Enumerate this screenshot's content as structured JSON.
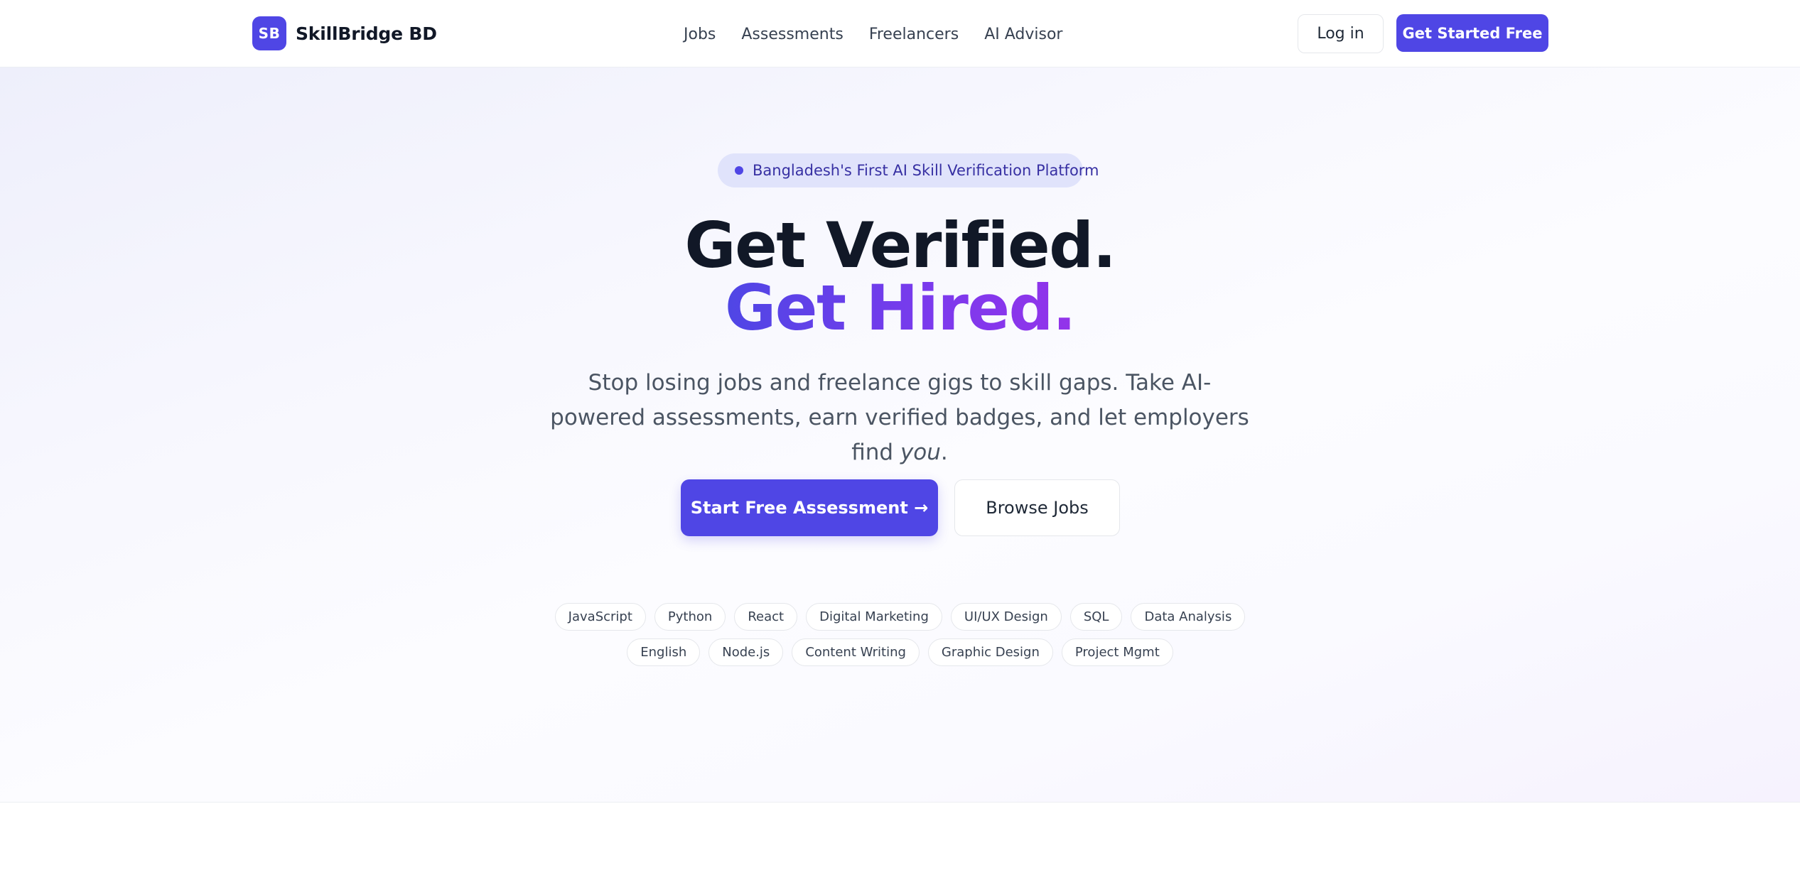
{
  "header": {
    "logo_initials": "SB",
    "brand_name": "SkillBridge BD",
    "nav": [
      {
        "label": "Jobs"
      },
      {
        "label": "Assessments"
      },
      {
        "label": "Freelancers"
      },
      {
        "label": "AI Advisor"
      }
    ],
    "login_label": "Log in",
    "cta_label": "Get Started Free"
  },
  "hero": {
    "badge_text": "Bangladesh's First AI Skill Verification Platform",
    "title_line1": "Get Verified.",
    "title_line2": "Get Hired.",
    "subtitle_main": "Stop losing jobs and freelance gigs to skill gaps. Take AI-powered assessments, earn verified badges, and let employers find ",
    "subtitle_emphasis": "you",
    "subtitle_end": ".",
    "primary_button": "Start Free Assessment →",
    "secondary_button": "Browse Jobs",
    "skills_row1": [
      "JavaScript",
      "Python",
      "React",
      "Digital Marketing",
      "UI/UX Design",
      "SQL",
      "Data Analysis"
    ],
    "skills_row2": [
      "English",
      "Node.js",
      "Content Writing",
      "Graphic Design",
      "Project Mgmt"
    ]
  },
  "colors": {
    "brand": "#4f46e5",
    "gradient_end": "#9333ea",
    "heading": "#111827",
    "body_text": "#4b5563"
  }
}
